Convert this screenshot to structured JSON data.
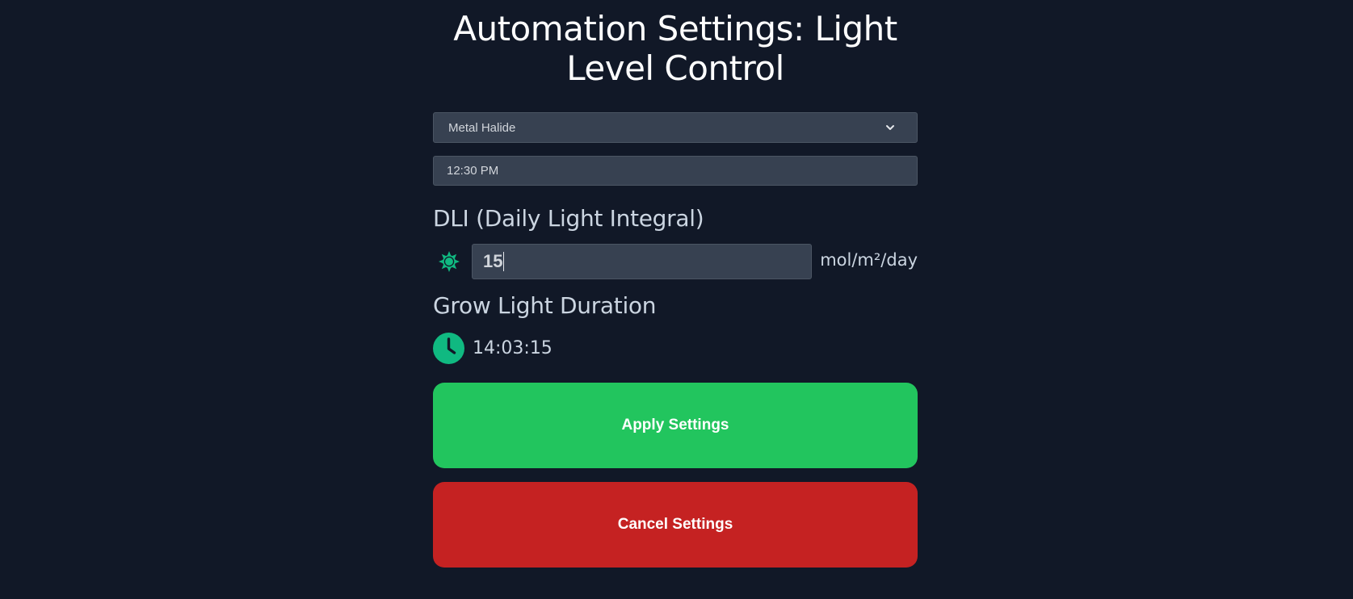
{
  "page": {
    "title": "Automation Settings: Light Level Control"
  },
  "form": {
    "light_type": {
      "selected": "Metal Halide",
      "icon": "chevron-down-icon"
    },
    "time": {
      "value": "12:30 PM"
    },
    "dli": {
      "label": "DLI (Daily Light Integral)",
      "value": "15",
      "unit": "mol/m²/day",
      "icon": "sun-icon",
      "icon_color": "#10b981"
    },
    "duration": {
      "label": "Grow Light Duration",
      "value": "14:03:15",
      "icon": "clock-icon",
      "icon_color": "#10b981"
    }
  },
  "actions": {
    "apply_label": "Apply Settings",
    "apply_color": "#22c55e",
    "cancel_label": "Cancel Settings",
    "cancel_color": "#c52222"
  }
}
